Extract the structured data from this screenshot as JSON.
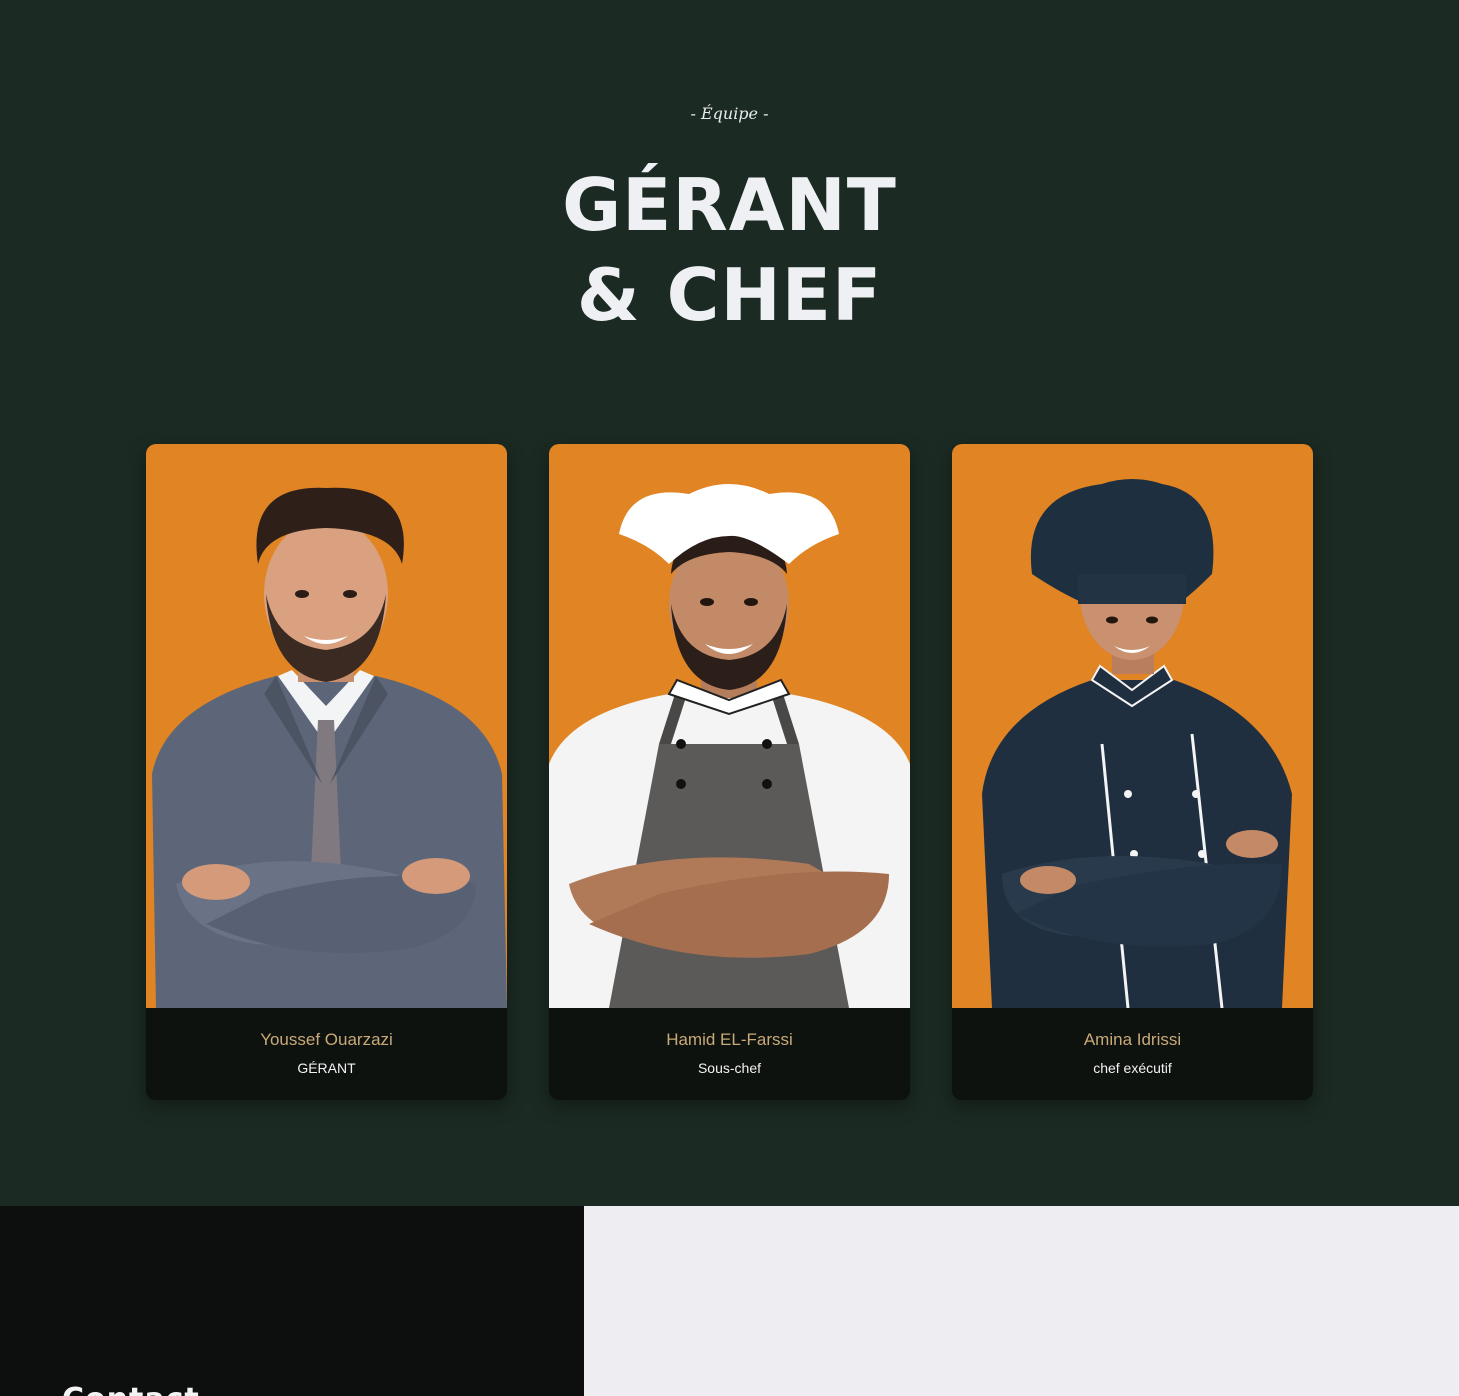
{
  "section": {
    "eyebrow": "- Équipe -",
    "title_line1": "GÉRANT",
    "title_line2": "& CHEF"
  },
  "team": [
    {
      "name": "Youssef Ouarzazi",
      "role": "GÉRANT",
      "photo": "man-in-grey-suit-portrait"
    },
    {
      "name": "Hamid EL-Farssi",
      "role": "Sous-chef",
      "photo": "chef-in-white-toque-and-apron-portrait"
    },
    {
      "name": "Amina Idrissi",
      "role": "chef exécutif",
      "photo": "woman-chef-in-navy-uniform-portrait"
    }
  ],
  "contact": {
    "heading": "Contact"
  },
  "colors": {
    "section_bg": "#1b2a22",
    "card_photo_bg": "#e08424",
    "card_info_bg": "#0d120f",
    "name_color": "#c9a977",
    "contact_right_bg": "#eeeef2"
  }
}
